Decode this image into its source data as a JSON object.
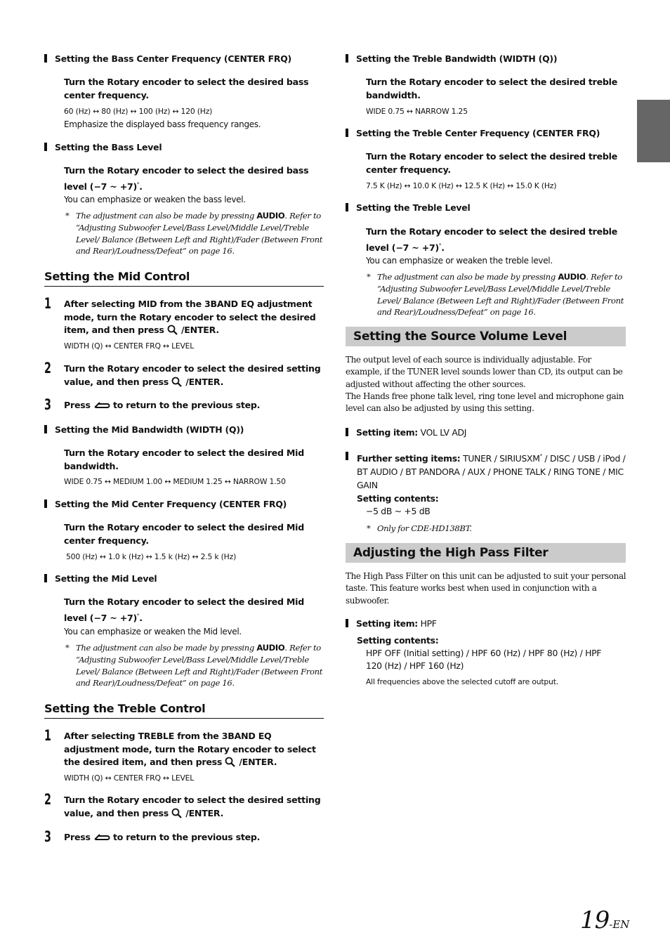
{
  "page": {
    "number": "19",
    "suffix": "-EN",
    "tab_color": "#666666",
    "band_color": "#cbcbcb"
  },
  "left": {
    "bass_center": {
      "heading": "Setting the Bass Center Frequency (CENTER FRQ)",
      "instr_a": "Turn the ",
      "instr_b": "Rotary encoder",
      "instr_c": " to select the desired bass center frequency.",
      "options": "60 (Hz) ↔ 80 (Hz) ↔ 100 (Hz) ↔ 120 (Hz)",
      "desc": "Emphasize the displayed bass frequency ranges."
    },
    "bass_level": {
      "heading": "Setting the Bass Level",
      "instr_a": "Turn the ",
      "instr_b": "Rotary encoder",
      "instr_c": " to select the desired bass level (−7 ~ +7)",
      "instr_sup": "*",
      "instr_d": ".",
      "desc": "You can emphasize or weaken the bass level.",
      "note_a": "The adjustment can also be made by pressing ",
      "note_b": "AUDIO",
      "note_c": ". Refer to “Adjusting Subwoofer Level/Bass Level/Middle Level/Treble Level/ Balance (Between Left and Right)/Fader (Between Front and Rear)/Loudness/Defeat” on page 16."
    },
    "mid_control": {
      "title": "Setting the Mid Control",
      "step1_num": "1",
      "step1_a": "After selecting MID from the 3BAND EQ adjustment mode, turn the ",
      "step1_b": "Rotary encoder",
      "step1_c": " to select the desired item, and then press ",
      "step1_d": " /ENTER.",
      "step1_options": "WIDTH (Q) ↔ CENTER FRQ ↔ LEVEL",
      "step2_num": "2",
      "step2_a": "Turn the ",
      "step2_b": "Rotary encoder",
      "step2_c": " to select the desired setting value, and then press ",
      "step2_d": " /ENTER.",
      "step3_num": "3",
      "step3_a": "Press ",
      "step3_b": " to return to the previous step."
    },
    "mid_bandwidth": {
      "heading": "Setting the Mid Bandwidth (WIDTH (Q))",
      "instr_a": "Turn the ",
      "instr_b": "Rotary encoder",
      "instr_c": " to select the desired Mid bandwidth.",
      "options": "WIDE 0.75 ↔ MEDIUM 1.00 ↔ MEDIUM 1.25 ↔ NARROW 1.50"
    },
    "mid_center": {
      "heading": "Setting the Mid Center Frequency (CENTER FRQ)",
      "instr_a": "Turn the ",
      "instr_b": "Rotary encoder",
      "instr_c": " to select the desired Mid center frequency.",
      "options": "500 (Hz) ↔ 1.0 k (Hz) ↔ 1.5 k (Hz) ↔ 2.5 k (Hz)"
    },
    "mid_level": {
      "heading": "Setting the Mid Level",
      "instr_a": "Turn the ",
      "instr_b": "Rotary encoder",
      "instr_c": " to select the desired Mid level (−7 ~ +7)",
      "instr_sup": "*",
      "instr_d": ".",
      "desc": "You can emphasize or weaken the Mid level.",
      "note_a": "The adjustment can also be made by pressing ",
      "note_b": "AUDIO",
      "note_c": ". Refer to “Adjusting Subwoofer Level/Bass Level/Middle Level/Treble Level/ Balance (Between Left and Right)/Fader (Between Front and Rear)/Loudness/Defeat” on page 16."
    },
    "treble_control": {
      "title": "Setting the Treble Control",
      "step1_num": "1",
      "step1_a": "After selecting TREBLE from the 3BAND EQ adjustment mode, turn the ",
      "step1_b": "Rotary encoder",
      "step1_c": " to select the desired item, and then press ",
      "step1_d": " /ENTER.",
      "step1_options": "WIDTH (Q) ↔ CENTER FRQ ↔ LEVEL",
      "step2_num": "2",
      "step2_a": "Turn the ",
      "step2_b": "Rotary encoder",
      "step2_c": " to select the desired setting value, and then press ",
      "step2_d": " /ENTER.",
      "step3_num": "3",
      "step3_a": "Press ",
      "step3_b": " to return to the previous step."
    }
  },
  "right": {
    "treble_bandwidth": {
      "heading": "Setting the Treble Bandwidth (WIDTH (Q))",
      "instr_a": "Turn the ",
      "instr_b": "Rotary encoder",
      "instr_c": " to select the desired treble bandwidth.",
      "options": "WIDE 0.75 ↔ NARROW 1.25"
    },
    "treble_center": {
      "heading": "Setting the Treble Center Frequency (CENTER FRQ)",
      "instr_a": "Turn the ",
      "instr_b": "Rotary encoder",
      "instr_c": " to select the desired treble center frequency.",
      "options": "7.5 K (Hz) ↔ 10.0 K (Hz) ↔ 12.5 K (Hz) ↔ 15.0 K (Hz)"
    },
    "treble_level": {
      "heading": "Setting the Treble Level",
      "instr_a": "Turn the ",
      "instr_b": "Rotary encoder",
      "instr_c": " to select the desired treble level (−7 ~ +7)",
      "instr_sup": "*",
      "instr_d": ".",
      "desc": "You can emphasize or weaken the treble level.",
      "note_a": "The adjustment can also be made by pressing ",
      "note_b": "AUDIO",
      "note_c": ". Refer to “Adjusting Subwoofer Level/Bass Level/Middle Level/Treble Level/ Balance (Between Left and Right)/Fader (Between Front and Rear)/Loudness/Defeat” on page 16."
    },
    "source_volume": {
      "title": "Setting the Source Volume Level",
      "para1": "The output level of each source is individually adjustable. For example, if the TUNER level sounds lower than CD, its output can be adjusted without affecting the other sources.",
      "para2": "The Hands free phone talk level, ring tone level and microphone gain level can also be adjusted by using this setting.",
      "item_label": "Setting item:",
      "item_value": " VOL LV ADJ",
      "further_label": "Further setting items:",
      "further_a": " TUNER / SIRIUSXM",
      "further_sup": "*",
      "further_b": " / DISC / USB / iPod / BT AUDIO / BT PANDORA / AUX / PHONE TALK / RING TONE / MIC GAIN",
      "contents_label": "Setting contents:",
      "contents_value": "−5 dB ~ +5 dB",
      "note": "Only for CDE-HD138BT."
    },
    "hpf": {
      "title": "Adjusting the High Pass Filter",
      "para": "The High Pass Filter on this unit can be adjusted to suit your personal taste. This feature works best when used in conjunction with a subwoofer.",
      "item_label": "Setting item:",
      "item_value": " HPF",
      "contents_label": "Setting contents:",
      "contents_value": "HPF OFF (Initial setting) / HPF 60 (Hz) / HPF 80 (Hz) / HPF 120 (Hz) / HPF 160 (Hz)",
      "desc": "All frequencies above the selected cutoff are output."
    }
  }
}
